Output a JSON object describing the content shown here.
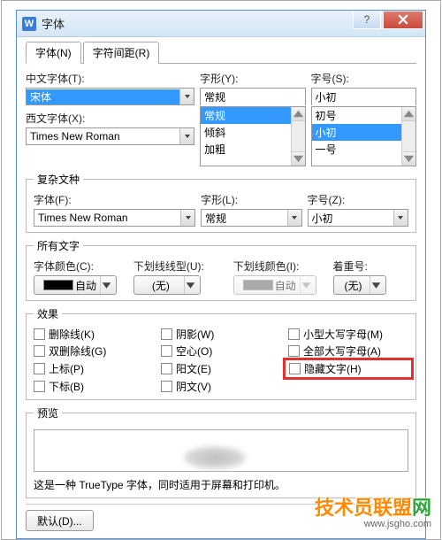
{
  "title": "字体",
  "tabs": [
    "字体(N)",
    "字符间距(R)"
  ],
  "main": {
    "cn_label": "中文字体(T):",
    "cn_value": "宋体",
    "xing_label": "字形(Y):",
    "xing_field": "常规",
    "xing_list": [
      "常规",
      "倾斜",
      "加粗"
    ],
    "hao_label": "字号(S):",
    "hao_field": "小初",
    "hao_list": [
      "初号",
      "小初",
      "一号"
    ],
    "xi_label": "西文字体(X):",
    "xi_value": "Times New Roman"
  },
  "complex": {
    "legend": "复杂文种",
    "font_label": "字体(F):",
    "font_value": "Times New Roman",
    "xing_label": "字形(L):",
    "xing_value": "常规",
    "hao_label": "字号(Z):",
    "hao_value": "小初"
  },
  "all": {
    "legend": "所有文字",
    "color_label": "字体颜色(C):",
    "color_value": "自动",
    "ustyle_label": "下划线线型(U):",
    "ustyle_value": "(无)",
    "ucolor_label": "下划线颜色(I):",
    "ucolor_value": "自动",
    "emph_label": "着重号:",
    "emph_value": "(无)"
  },
  "fx": {
    "legend": "效果",
    "items": [
      [
        "删除线(K)",
        "阴影(W)",
        "小型大写字母(M)"
      ],
      [
        "双删除线(G)",
        "空心(O)",
        "全部大写字母(A)"
      ],
      [
        "上标(P)",
        "阳文(E)",
        "隐藏文字(H)"
      ],
      [
        "下标(B)",
        "阴文(V)",
        ""
      ]
    ]
  },
  "preview": {
    "legend": "预览",
    "desc": "这是一种 TrueType 字体，同时适用于屏幕和打印机。"
  },
  "buttons": {
    "default": "默认(D)..."
  },
  "watermark": {
    "t1": "技术员联盟",
    "t2": "网",
    "url": "www.jsgho.com"
  }
}
